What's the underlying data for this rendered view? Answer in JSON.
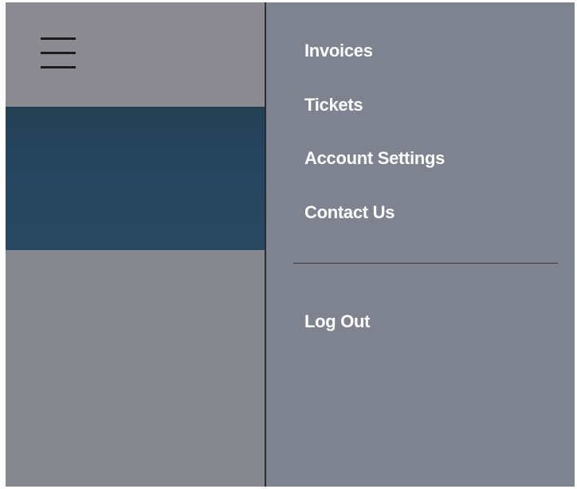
{
  "menu_button": {
    "icon": "hamburger-menu-icon"
  },
  "nav": {
    "items": [
      {
        "label": "Invoices"
      },
      {
        "label": "Tickets"
      },
      {
        "label": "Account Settings"
      },
      {
        "label": "Contact Us"
      }
    ],
    "logout_label": "Log Out"
  },
  "colors": {
    "panel_background": "#7f838f",
    "highlight_block": "#254560",
    "text": "#ffffff",
    "divider": "#2b2c33"
  }
}
